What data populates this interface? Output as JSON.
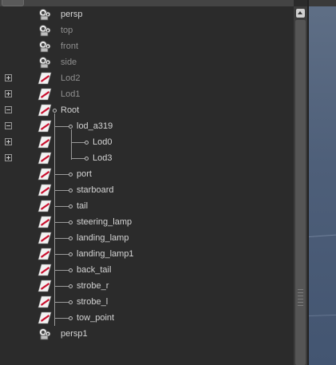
{
  "outliner": {
    "items": [
      {
        "label": "persp",
        "icon": "camera-icon",
        "dim": true
      },
      {
        "label": "top",
        "icon": "camera-icon",
        "dim": true
      },
      {
        "label": "front",
        "icon": "camera-icon",
        "dim": true
      },
      {
        "label": "side",
        "icon": "camera-icon",
        "dim": true
      },
      {
        "label": "Lod2",
        "icon": "transform-icon",
        "dim": true,
        "expander": "collapsed"
      },
      {
        "label": "Lod1",
        "icon": "transform-icon",
        "dim": true,
        "expander": "collapsed"
      },
      {
        "label": "Root",
        "icon": "transform-icon",
        "dim": false,
        "expander": "expanded"
      },
      {
        "label": "lod_a319",
        "icon": "transform-icon",
        "dim": false,
        "expander": "expanded"
      },
      {
        "label": "Lod0",
        "icon": "transform-icon",
        "dim": false,
        "expander": "collapsed"
      },
      {
        "label": "Lod3",
        "icon": "transform-icon",
        "dim": false,
        "expander": "collapsed"
      },
      {
        "label": "port",
        "icon": "transform-icon",
        "dim": false
      },
      {
        "label": "starboard",
        "icon": "transform-icon",
        "dim": false
      },
      {
        "label": "tail",
        "icon": "transform-icon",
        "dim": false
      },
      {
        "label": "steering_lamp",
        "icon": "transform-icon",
        "dim": false
      },
      {
        "label": "landing_lamp",
        "icon": "transform-icon",
        "dim": false
      },
      {
        "label": "landing_lamp1",
        "icon": "transform-icon",
        "dim": false
      },
      {
        "label": "back_tail",
        "icon": "transform-icon",
        "dim": false
      },
      {
        "label": "strobe_r",
        "icon": "transform-icon",
        "dim": false
      },
      {
        "label": "strobe_l",
        "icon": "transform-icon",
        "dim": false
      },
      {
        "label": "tow_point",
        "icon": "transform-icon",
        "dim": false
      },
      {
        "label": "persp1",
        "icon": "camera-icon",
        "dim": false
      }
    ]
  },
  "colors": {
    "background": "#2b2b2b",
    "text": "#d4d4d4",
    "text_dim": "#8f8f8f",
    "icon_accent": "#c8102e"
  }
}
